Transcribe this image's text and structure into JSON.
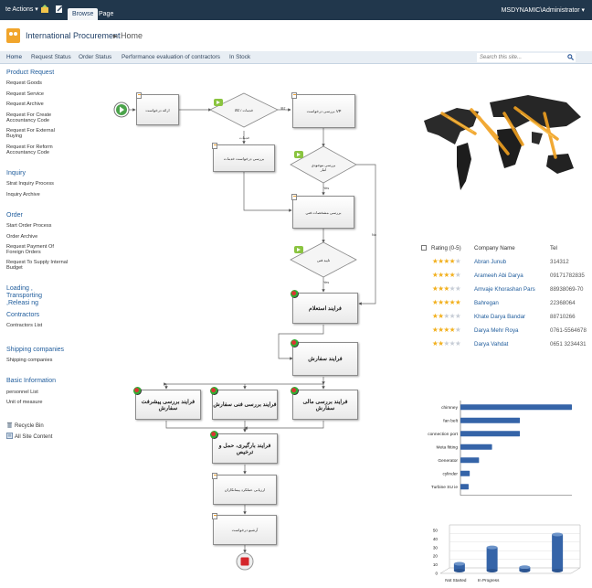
{
  "ribbon": {
    "site_actions": "te Actions ▾",
    "tab_browse": "Browse",
    "tab_page": "Page",
    "user": "MSDYNAMIC\\Administrator ▾"
  },
  "titlebar": {
    "site_title": "International Procurement",
    "separator": "▸",
    "current": "Home"
  },
  "topnav": {
    "items": [
      "Home",
      "Request Status",
      "Order Status",
      "Performance evaluation of contractors",
      "In Stock"
    ],
    "search_placeholder": "Search this site..."
  },
  "leftnav": {
    "sections": [
      {
        "heading": "Product Request",
        "items": [
          "Request Goods",
          "Request Service",
          "Request Archive",
          "Request For Create Accountancy Code",
          "Request For External Buying",
          "Request For Reform Accountancy Code"
        ]
      },
      {
        "heading": "Inquiry",
        "items": [
          "Strat Inquiry Process",
          "Inquiry Archive"
        ]
      },
      {
        "heading": "Order",
        "items": [
          "Start Order Process",
          "Order Archive",
          "Request Payment Of Foreign Orders",
          "Request To Supply Internal Budget"
        ]
      },
      {
        "heading": "Loading , Transporting ,Releasi ng",
        "items": []
      },
      {
        "heading": "Contractors",
        "items": [
          "Contractors List"
        ]
      },
      {
        "heading": "Shipping companies",
        "items": [
          "Shipping companies"
        ]
      },
      {
        "heading": "Basic Information",
        "items": [
          "personnel List",
          "Unit of measure"
        ]
      }
    ],
    "recycle_bin": "Recycle Bin",
    "all_site_content": "All Site Content"
  },
  "workflow": {
    "start_request": "ارائه درخواست",
    "decision_goods_service": "خدمات / کالا",
    "request_review_vp": "بررسی درخواست VP",
    "service_request_review": "بررسی درخواست خدمات",
    "decision_stock": "بررسی موجودی انبار",
    "tech_spec_review": "بررسی مشخصات فنی",
    "decision_tech": "تایید فنی",
    "inquiry_process": "فرایند استعلام",
    "order_process": "فرایند سفارش",
    "progress_review": "فرایند بررسی پیشرفت سفارش",
    "tech_review": "فرایند بررسی فنی سفارش",
    "financial_review": "فرایند بررسی مالی سفارش",
    "loading_process": "فرایند بارگیری، حمل و ترخیص",
    "contractor_eval": "ارزیابی عملکرد پیمانکاران",
    "archive_request": "آرشیو درخواست",
    "lbl_service": "خدمات",
    "lbl_goods": "کالا",
    "lbl_yes1": "Yes",
    "lbl_yes2": "Yes",
    "lbl_no": "No"
  },
  "contacts": {
    "headers": {
      "rating": "Rating (0-5)",
      "company": "Company Name",
      "tel": "Tel"
    },
    "rows": [
      {
        "stars": 4,
        "company": "Abran Junub",
        "tel": "314312"
      },
      {
        "stars": 4,
        "company": "Arameeh Abi Darya",
        "tel": "09171782835"
      },
      {
        "stars": 3,
        "company": "Amvaje Khorashan Pars",
        "tel": "88938069-70"
      },
      {
        "stars": 5,
        "company": "Bahregan",
        "tel": "22368064"
      },
      {
        "stars": 2,
        "company": "Khate Darya Bandar",
        "tel": "88710266"
      },
      {
        "stars": 4,
        "company": "Darya Mehr Roya",
        "tel": "0761-5564678"
      },
      {
        "stars": 2,
        "company": "Darya Vahdat",
        "tel": "0651 3234431"
      }
    ]
  },
  "colors": {
    "ribbon_bg": "#21374c",
    "link": "#1f5c9c",
    "bar": "#3564a8",
    "star_on": "#f2b01e",
    "star_off": "#c7cdd6"
  },
  "chart_data": [
    {
      "type": "bar",
      "orientation": "horizontal",
      "categories": [
        "chimney",
        "fan belt",
        "connection port",
        "Meta fitting",
        "Generator",
        "cylinder",
        "Turbine SU ie"
      ],
      "values": [
        300,
        160,
        160,
        85,
        50,
        25,
        22
      ],
      "xticks": [
        "0",
        "50",
        "100",
        "150",
        "200",
        "250",
        "300"
      ],
      "xlim": [
        0,
        300
      ],
      "title": "",
      "xlabel": "",
      "ylabel": ""
    },
    {
      "type": "bar",
      "orientation": "vertical-3d",
      "categories": [
        "Not Started",
        "In Progress",
        "",
        ""
      ],
      "values": [
        8,
        27,
        4,
        42
      ],
      "yticks": [
        "0",
        "10",
        "20",
        "30",
        "40",
        "50"
      ],
      "ylim": [
        0,
        50
      ],
      "title": "",
      "xlabel": "",
      "ylabel": ""
    }
  ]
}
